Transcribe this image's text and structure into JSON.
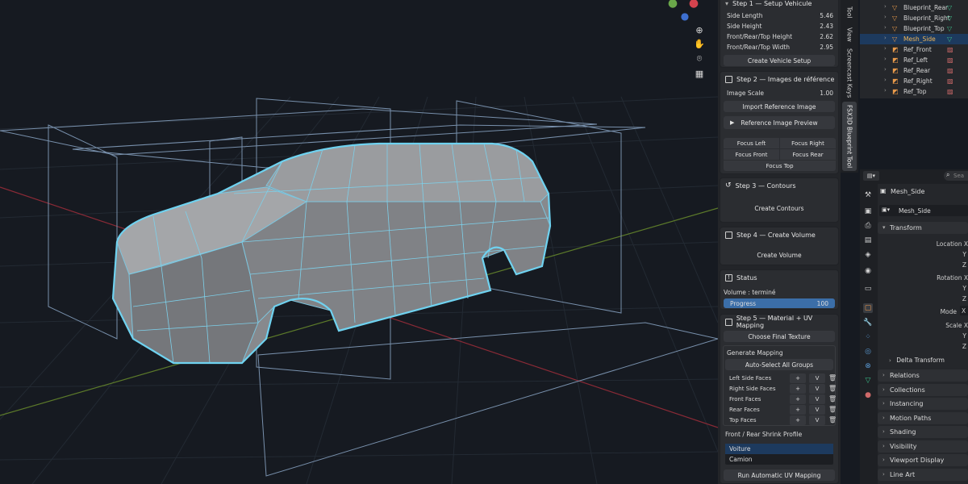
{
  "colors": {
    "accent": "#4a9ad4",
    "progress_fill": "#3b6ea8",
    "selection": "#1d3a5e",
    "outline": "#6fd2f0"
  },
  "step1": {
    "title": "Step 1 — Setup Vehicule",
    "fields": [
      {
        "label": "Side Length",
        "value": "5.46"
      },
      {
        "label": "Side Height",
        "value": "2.43"
      },
      {
        "label": "Front/Rear/Top Height",
        "value": "2.62"
      },
      {
        "label": "Front/Rear/Top Width",
        "value": "2.95"
      }
    ],
    "button": "Create Vehicle Setup"
  },
  "step2": {
    "title": "Step 2 — Images de référence",
    "image_scale_label": "Image Scale",
    "image_scale_value": "1.00",
    "import_button": "Import Reference Image",
    "preview_button": "Reference Image Preview",
    "focus_left": "Focus Left",
    "focus_right": "Focus Right",
    "focus_front": "Focus Front",
    "focus_rear": "Focus Rear",
    "focus_top": "Focus Top"
  },
  "step3": {
    "title": "Step 3 — Contours",
    "button": "Create Contours"
  },
  "step4": {
    "title": "Step 4 — Create Volume",
    "button": "Create Volume"
  },
  "status": {
    "title": "Status",
    "text": "Volume : terminé",
    "progress_label": "Progress",
    "progress_value": "100",
    "progress_fraction": 1.0
  },
  "step5": {
    "title": "Step 5 — Material + UV Mapping",
    "choose_texture": "Choose Final Texture",
    "generate_mapping": "Generate Mapping",
    "auto_select": "Auto-Select All Groups",
    "faces": [
      {
        "label": "Left Side Faces"
      },
      {
        "label": "Right Side Faces"
      },
      {
        "label": "Front Faces"
      },
      {
        "label": "Rear Faces"
      },
      {
        "label": "Top Faces"
      }
    ],
    "plus": "+",
    "v": "V",
    "shrink_title": "Front / Rear Shrink Profile",
    "profile_options": [
      "Voiture",
      "Camion"
    ],
    "profile_selected": "Voiture",
    "run_button": "Run Automatic UV Mapping"
  },
  "tabs": [
    "Tool",
    "View",
    "Screencast Keys",
    "FSX3D Blueprint Tool"
  ],
  "active_tab": "FSX3D Blueprint Tool",
  "outliner": {
    "items": [
      {
        "name": "Blueprint_Rear",
        "type": "mesh",
        "selected": false
      },
      {
        "name": "Blueprint_Right",
        "type": "mesh",
        "selected": false
      },
      {
        "name": "Blueprint_Top",
        "type": "mesh",
        "selected": false
      },
      {
        "name": "Mesh_Side",
        "type": "mesh",
        "selected": true
      },
      {
        "name": "Ref_Front",
        "type": "image",
        "selected": false
      },
      {
        "name": "Ref_Left",
        "type": "image",
        "selected": false
      },
      {
        "name": "Ref_Rear",
        "type": "image",
        "selected": false
      },
      {
        "name": "Ref_Right",
        "type": "image",
        "selected": false
      },
      {
        "name": "Ref_Top",
        "type": "image",
        "selected": false
      }
    ]
  },
  "properties": {
    "search_placeholder": "Sea",
    "object_name": "Mesh_Side",
    "object_field": "Mesh_Side",
    "transform": "Transform",
    "location": "Location X",
    "rotation": "Rotation X",
    "mode": "Mode",
    "mode_value": "X",
    "scale": "Scale X",
    "y": "Y",
    "z": "Z",
    "delta": "Delta Transform",
    "panels": [
      "Relations",
      "Collections",
      "Instancing",
      "Motion Paths",
      "Shading",
      "Visibility",
      "Viewport Display",
      "Line Art"
    ]
  }
}
